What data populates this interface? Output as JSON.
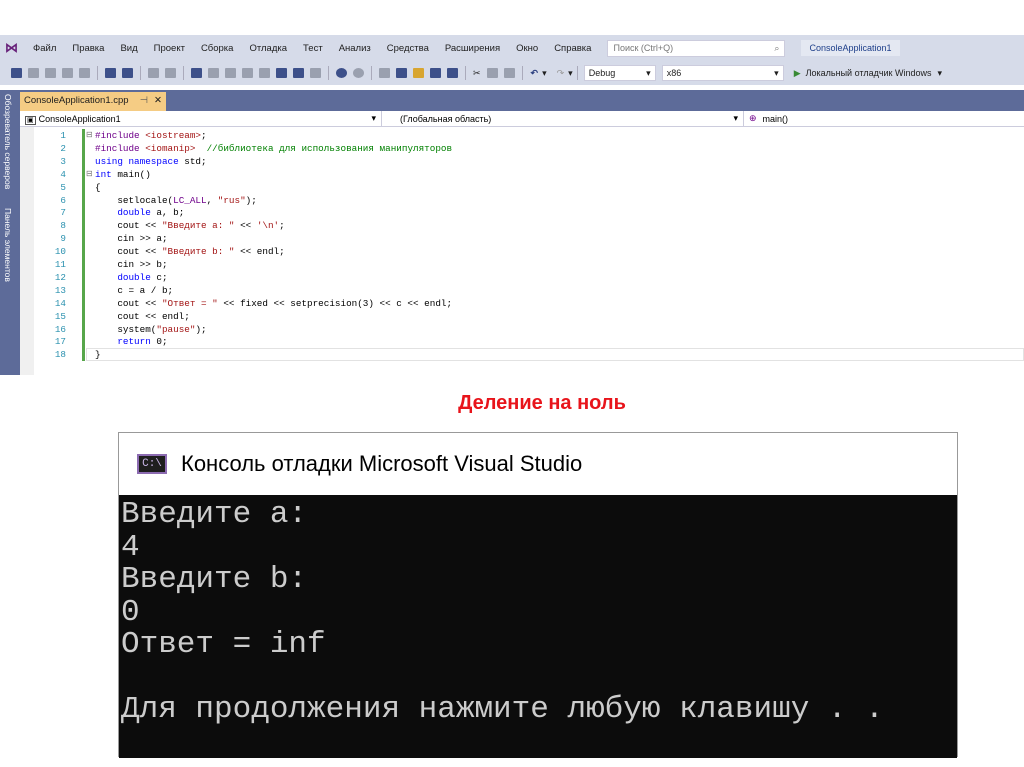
{
  "menu": {
    "items": [
      "Файл",
      "Правка",
      "Вид",
      "Проект",
      "Сборка",
      "Отладка",
      "Тест",
      "Анализ",
      "Средства",
      "Расширения",
      "Окно",
      "Справка"
    ],
    "search_placeholder": "Поиск (Ctrl+Q)",
    "project": "ConsoleApplication1"
  },
  "toolbar": {
    "config": "Debug",
    "platform": "x86",
    "run": "Локальный отладчик Windows"
  },
  "sidebar": {
    "server_explorer": "Обозреватель серверов",
    "toolbox": "Панель элементов"
  },
  "tab": {
    "name": "ConsoleApplication1.cpp",
    "pin": "⊣",
    "close": "✕"
  },
  "navbar": {
    "project": "ConsoleApplication1",
    "scope": "(Глобальная область)",
    "member": "main()"
  },
  "code": [
    [
      [
        "mac",
        "#include "
      ],
      [
        "str",
        "<iostream>"
      ],
      [
        "",
        "; "
      ]
    ],
    [
      [
        "mac",
        "#include "
      ],
      [
        "str",
        "<iomanip>"
      ],
      [
        "cm",
        "  //библиотека для использования манипуляторов"
      ]
    ],
    [
      [
        "kw",
        "using namespace "
      ],
      [
        "",
        "std;"
      ]
    ],
    [
      [
        "kw",
        "int "
      ],
      [
        "",
        "main()"
      ]
    ],
    [
      [
        "",
        "{"
      ]
    ],
    [
      [
        "",
        "    setlocale("
      ],
      [
        "mac",
        "LC_ALL"
      ],
      [
        "",
        ", "
      ],
      [
        "str",
        "\"rus\""
      ],
      [
        "",
        ");"
      ]
    ],
    [
      [
        "kw",
        "    double "
      ],
      [
        "",
        "a, b;"
      ]
    ],
    [
      [
        "",
        "    cout << "
      ],
      [
        "str",
        "\"Введите a: \""
      ],
      [
        "",
        " << "
      ],
      [
        "chr",
        "'\\n'"
      ],
      [
        "",
        ";"
      ]
    ],
    [
      [
        "",
        "    cin >> a;"
      ]
    ],
    [
      [
        "",
        "    cout << "
      ],
      [
        "str",
        "\"Введите b: \""
      ],
      [
        "",
        " << endl;"
      ]
    ],
    [
      [
        "",
        "    cin >> b;"
      ]
    ],
    [
      [
        "kw",
        "    double "
      ],
      [
        "",
        "c;"
      ]
    ],
    [
      [
        "",
        "    c = a / b;"
      ]
    ],
    [
      [
        "",
        "    cout << "
      ],
      [
        "str",
        "\"Ответ = \""
      ],
      [
        "",
        " << fixed << setprecision(3) << c << endl;"
      ]
    ],
    [
      [
        "",
        "    cout << endl;"
      ]
    ],
    [
      [
        "",
        "    system("
      ],
      [
        "str",
        "\"pause\""
      ],
      [
        "",
        ");"
      ]
    ],
    [
      [
        "kw",
        "    return "
      ],
      [
        "",
        "0;"
      ]
    ],
    [
      [
        "",
        "}"
      ]
    ]
  ],
  "heading": "Деление на ноль",
  "console": {
    "title": "Консоль отладки Microsoft Visual Studio",
    "icon_text": "C:\\",
    "lines": [
      "Введите a:",
      "4",
      "Введите b:",
      "0",
      "Ответ = inf",
      "",
      "Для продолжения нажмите любую клавишу . ."
    ]
  }
}
